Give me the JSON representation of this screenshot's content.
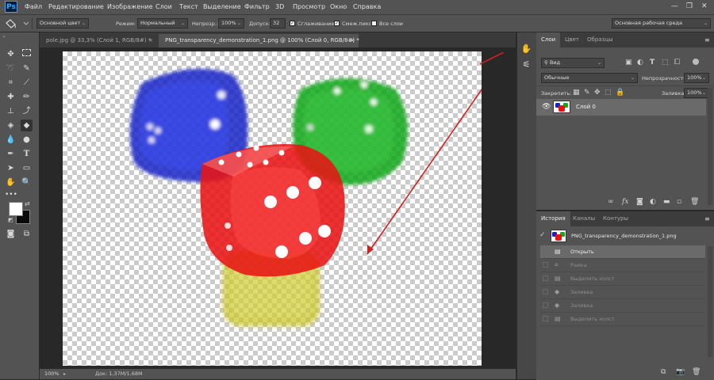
{
  "app": {
    "logo": "Ps"
  },
  "menu": [
    "Файл",
    "Редактирование",
    "Изображение",
    "Слои",
    "Текст",
    "Выделение",
    "Фильтр",
    "3D",
    "Просмотр",
    "Окно",
    "Справка"
  ],
  "window_controls": {
    "minimize": "—",
    "restore": "❐",
    "close": "✕"
  },
  "options": {
    "preset": "Основной цвет",
    "mode_label": "Режим:",
    "mode_value": "Нормальный",
    "opacity_label": "Непрозр.:",
    "opacity_value": "100%",
    "tolerance_label": "Допуск:",
    "tolerance_value": "32",
    "antialias_label": "Сглаживание",
    "contiguous_label": "Смеж.пикс",
    "all_layers_label": "Все слои",
    "workspace": "Основная рабочая среда"
  },
  "tabs": [
    {
      "label": "pole.jpg @ 33,3% (Слой 1, RGB/8#) *",
      "close": "×"
    },
    {
      "label": "PNG_transparency_demonstration_1.png @ 100% (Слой 0, RGB/8#) *",
      "close": "×"
    }
  ],
  "status": {
    "zoom": "100%",
    "doc": "Док: 1,37M/1,68M"
  },
  "layers_panel": {
    "tabs": [
      "Слои",
      "Цвет",
      "Образцы"
    ],
    "search_value": "Вид",
    "blend_mode": "Обычные",
    "opacity_label": "Непрозрачность:",
    "opacity_value": "100%",
    "lock_label": "Закрепить:",
    "fill_label": "Заливка:",
    "fill_value": "100%",
    "layer_name": "Слой 0"
  },
  "history_panel": {
    "tabs": [
      "История",
      "Каналы",
      "Контуры"
    ],
    "snapshot": "PNG_transparency_demonstration_1.png",
    "items": [
      "Открыть",
      "Рамка",
      "Выделить холст",
      "Заливка",
      "Заливка",
      "Выделить холст"
    ]
  },
  "colors": {
    "accent_arrow": "#d42020",
    "die_blue": "#1424c8",
    "die_green": "#12a818",
    "die_red": "#e81414",
    "die_yellow": "#c8c41a"
  }
}
